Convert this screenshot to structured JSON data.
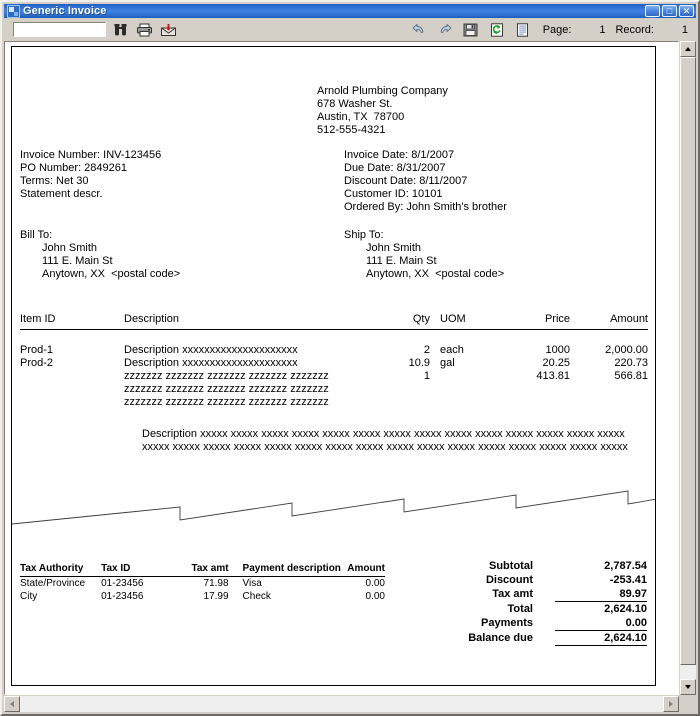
{
  "window": {
    "title": "Generic Invoice",
    "icon": "invoice-window-icon",
    "minimize_label": "_",
    "maximize_label": "□",
    "close_label": "✕"
  },
  "toolbar": {
    "find_value": "",
    "find_placeholder": "",
    "find_icon": "binoculars-icon",
    "print_icon": "printer-icon",
    "export_icon": "export-icon",
    "prev_page_icon": "previous-page-icon",
    "next_page_icon": "next-page-icon",
    "save_icon": "save-icon",
    "refresh_icon": "refresh-icon",
    "details_icon": "document-details-icon",
    "page_label": "Page:",
    "page_value": "1",
    "record_label": "Record:",
    "record_value": "1"
  },
  "invoice": {
    "company": {
      "name": "Arnold Plumbing Company",
      "street": "678 Washer St.",
      "city_state_zip": "Austin, TX  78700",
      "phone": "512-555-4321"
    },
    "left_fields": [
      "Invoice Number: INV-123456",
      "PO Number: 2849261",
      "Terms: Net 30",
      "Statement descr."
    ],
    "right_fields": [
      "Invoice Date: 8/1/2007",
      "Due Date: 8/31/2007",
      "Discount Date: 8/11/2007",
      "Customer ID: 10101",
      "Ordered By: John Smith's brother"
    ],
    "bill_to": {
      "label": "Bill To:",
      "lines": [
        "John Smith",
        "111 E. Main St",
        "Anytown, XX  <postal code>"
      ]
    },
    "ship_to": {
      "label": "Ship To:",
      "lines": [
        "John Smith",
        "111 E. Main St",
        "Anytown, XX  <postal code>"
      ]
    },
    "items_header": {
      "item_id": "Item ID",
      "description": "Description",
      "qty": "Qty",
      "uom": "UOM",
      "price": "Price",
      "amount": "Amount"
    },
    "items": [
      {
        "item_id": "Prod-1",
        "description": "Description xxxxxxxxxxxxxxxxxxxxx",
        "qty": "2",
        "uom": "each",
        "price": "1000",
        "amount": "2,000.00"
      },
      {
        "item_id": "Prod-2",
        "description": "Description xxxxxxxxxxxxxxxxxxxxx",
        "qty": "10.9",
        "uom": "gal",
        "price": "20.25",
        "amount": "220.73"
      },
      {
        "item_id": "",
        "description": "zzzzzzz zzzzzzz zzzzzzz zzzzzzz zzzzzzz",
        "qty": "1",
        "uom": "",
        "price": "413.81",
        "amount": "566.81"
      },
      {
        "item_id": "",
        "description": "zzzzzzz zzzzzzz zzzzzzz zzzzzzz zzzzzzz",
        "qty": "",
        "uom": "",
        "price": "",
        "amount": ""
      },
      {
        "item_id": "",
        "description": "zzzzzzz zzzzzzz zzzzzzz zzzzzzz zzzzzzz",
        "qty": "",
        "uom": "",
        "price": "",
        "amount": ""
      }
    ],
    "long_description": "Description xxxxx xxxxx xxxxx xxxxx xxxxx xxxxx xxxxx xxxxx xxxxx xxxxx xxxxx xxxxx xxxxx xxxxx xxxxx xxxxx xxxxx xxxxx xxxxx xxxxx xxxxx xxxxx xxxxx xxxxx xxxxx xxxxx xxxxx xxxxx xxxxx xxxxx",
    "tax_header": {
      "authority": "Tax Authority",
      "tax_id": "Tax ID",
      "tax_amt": "Tax amt",
      "payment_description": "Payment description",
      "amount": "Amount"
    },
    "tax_rows": [
      {
        "authority": "State/Province",
        "tax_id": "01-23456",
        "tax_amt": "71.98",
        "payment_description": "Visa",
        "amount": "0.00"
      },
      {
        "authority": "City",
        "tax_id": "01-23456",
        "tax_amt": "17.99",
        "payment_description": "Check",
        "amount": "0.00"
      }
    ],
    "totals": [
      {
        "label": "Subtotal",
        "value": "2,787.54"
      },
      {
        "label": "Discount",
        "value": "-253.41"
      },
      {
        "label": "Tax amt",
        "value": "89.97"
      },
      {
        "label": "Total",
        "value": "2,624.10"
      },
      {
        "label": "Payments",
        "value": "0.00"
      },
      {
        "label": "Balance due",
        "value": "2,624.10"
      }
    ]
  },
  "scrollbars": {
    "v_up_icon": "scroll-up-arrow-icon",
    "v_down_icon": "scroll-down-arrow-icon",
    "h_left_icon": "scroll-left-arrow-icon",
    "h_right_icon": "scroll-right-arrow-icon"
  }
}
